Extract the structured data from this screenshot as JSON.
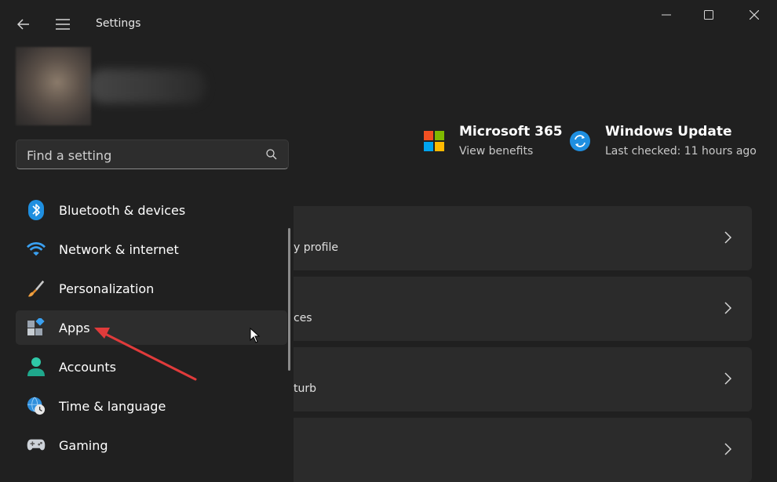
{
  "window": {
    "title": "Settings"
  },
  "search": {
    "placeholder": "Find a setting"
  },
  "nav": {
    "items": [
      {
        "label": "Bluetooth & devices",
        "icon": "bluetooth-icon"
      },
      {
        "label": "Network & internet",
        "icon": "wifi-icon"
      },
      {
        "label": "Personalization",
        "icon": "paintbrush-icon"
      },
      {
        "label": "Apps",
        "icon": "apps-icon",
        "selected": true
      },
      {
        "label": "Accounts",
        "icon": "accounts-icon"
      },
      {
        "label": "Time & language",
        "icon": "globe-clock-icon"
      },
      {
        "label": "Gaming",
        "icon": "gamepad-icon"
      }
    ]
  },
  "header": {
    "ms365": {
      "title": "Microsoft 365",
      "subtitle": "View benefits"
    },
    "windows_update": {
      "title": "Windows Update",
      "subtitle": "Last checked: 11 hours ago"
    }
  },
  "cards": [
    {
      "text": "y profile"
    },
    {
      "text": "ces"
    },
    {
      "text": "turb"
    },
    {
      "text": ""
    }
  ],
  "colors": {
    "background": "#202020",
    "card": "#2b2b2b",
    "accent_blue": "#0f7fd6",
    "annotation": "#e03b3b"
  }
}
